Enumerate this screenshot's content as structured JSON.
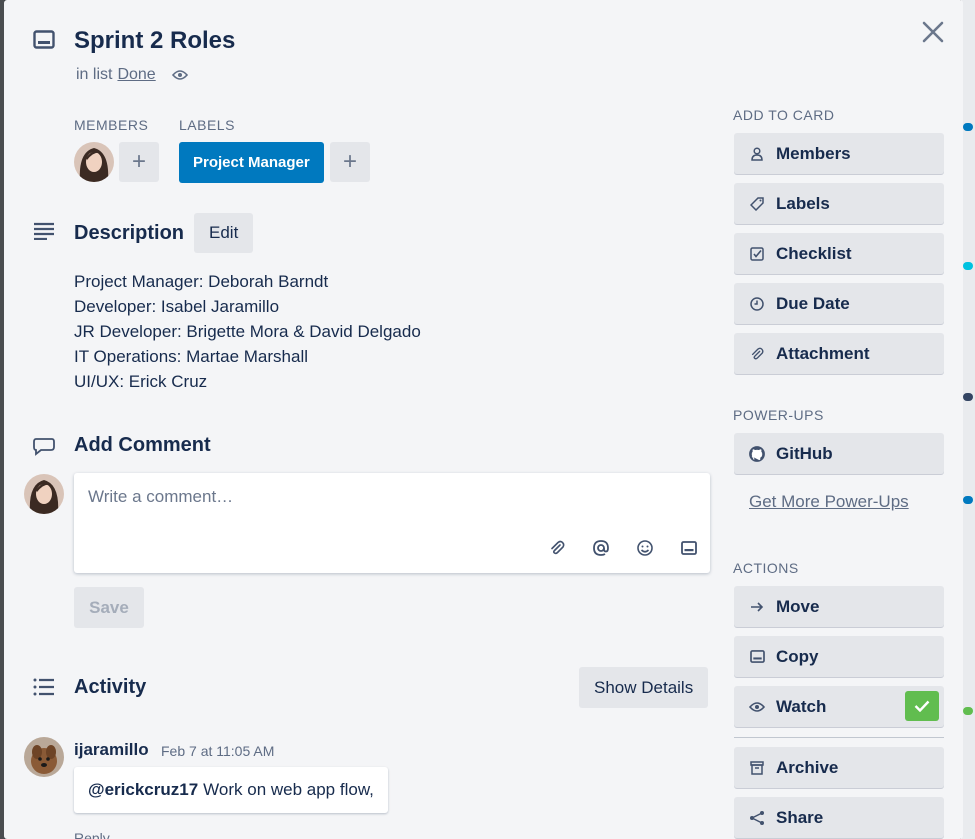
{
  "card": {
    "title": "Sprint 2 Roles",
    "in_list_prefix": "in list",
    "list_name": "Done"
  },
  "members": {
    "label": "MEMBERS",
    "add_symbol": "+"
  },
  "labels": {
    "label": "LABELS",
    "items": [
      "Project Manager"
    ],
    "add_symbol": "+"
  },
  "description": {
    "title": "Description",
    "edit_label": "Edit",
    "lines": [
      "Project Manager: Deborah Barndt",
      "Developer: Isabel Jaramillo",
      "JR Developer: Brigette Mora & David Delgado",
      "IT Operations: Martae Marshall",
      "UI/UX: Erick Cruz"
    ]
  },
  "comment": {
    "title": "Add Comment",
    "placeholder": "Write a comment…",
    "save_label": "Save",
    "tools": [
      "attachment-icon",
      "mention-icon",
      "emoji-icon",
      "card-icon"
    ]
  },
  "activity": {
    "title": "Activity",
    "show_details_label": "Show Details",
    "entries": [
      {
        "user": "ijaramillo",
        "time": "Feb 7 at 11:05 AM",
        "mention": "@erickcruz17",
        "text": "Work on web app flow,",
        "reply_label": "Reply"
      }
    ]
  },
  "sidebar": {
    "add_to_card_label": "ADD TO CARD",
    "add_to_card": [
      {
        "label": "Members",
        "icon": "person-icon"
      },
      {
        "label": "Labels",
        "icon": "tag-icon"
      },
      {
        "label": "Checklist",
        "icon": "checkbox-icon"
      },
      {
        "label": "Due Date",
        "icon": "clock-icon"
      },
      {
        "label": "Attachment",
        "icon": "paperclip-icon"
      }
    ],
    "power_ups_label": "POWER-UPS",
    "power_ups": [
      {
        "label": "GitHub",
        "icon": "github-icon"
      }
    ],
    "get_more_label": "Get More Power-Ups",
    "actions_label": "ACTIONS",
    "actions": [
      {
        "label": "Move",
        "icon": "arrow-right-icon"
      },
      {
        "label": "Copy",
        "icon": "card-icon"
      },
      {
        "label": "Watch",
        "icon": "eye-icon",
        "checked": true
      },
      {
        "label": "Archive",
        "icon": "archive-icon"
      },
      {
        "label": "Share",
        "icon": "share-icon"
      }
    ]
  },
  "colors": {
    "label_blue": "#0079bf",
    "watch_green": "#61bd4f",
    "button_gray": "#e4e6ea",
    "panel_bg": "#f4f5f7"
  }
}
